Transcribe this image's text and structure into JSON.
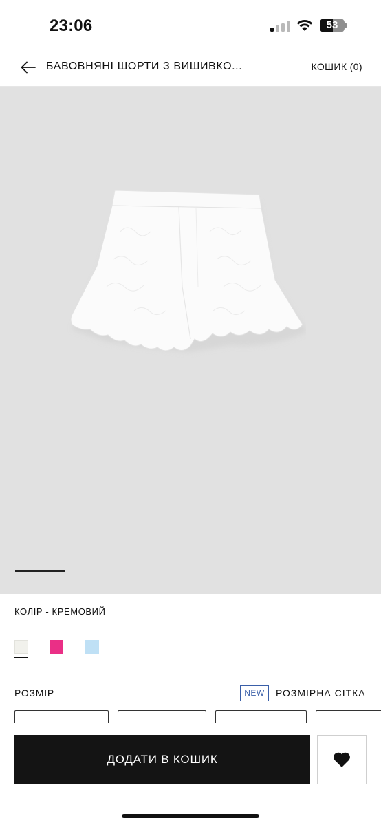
{
  "status_bar": {
    "time": "23:06",
    "battery_level": "53",
    "battery_fill_fraction": 0.53,
    "signal_bars_active": 1,
    "signal_bars_total": 4
  },
  "header": {
    "back_icon": "arrow-left-icon",
    "product_title": "БАВОВНЯНІ ШОРТИ З ВИШИВКО...",
    "cart_label": "КОШИК (0)"
  },
  "gallery": {
    "background_color": "#e1e1e1",
    "image_subject": "shorts",
    "active_slide_index": 0
  },
  "color": {
    "label": "КОЛІР - КРЕМОВИЙ",
    "swatches": [
      {
        "hex": "#f1f1ec",
        "selected": true
      },
      {
        "hex": "#ea2f86",
        "selected": false
      },
      {
        "hex": "#bfe0f5",
        "selected": false
      }
    ]
  },
  "size": {
    "label": "РОЗМІР",
    "new_badge": "NEW",
    "size_chart_link": "РОЗМІРНА СІТКА"
  },
  "actions": {
    "add_to_cart_label": "ДОДАТИ В КОШИК",
    "wishlist_icon": "heart-icon"
  }
}
